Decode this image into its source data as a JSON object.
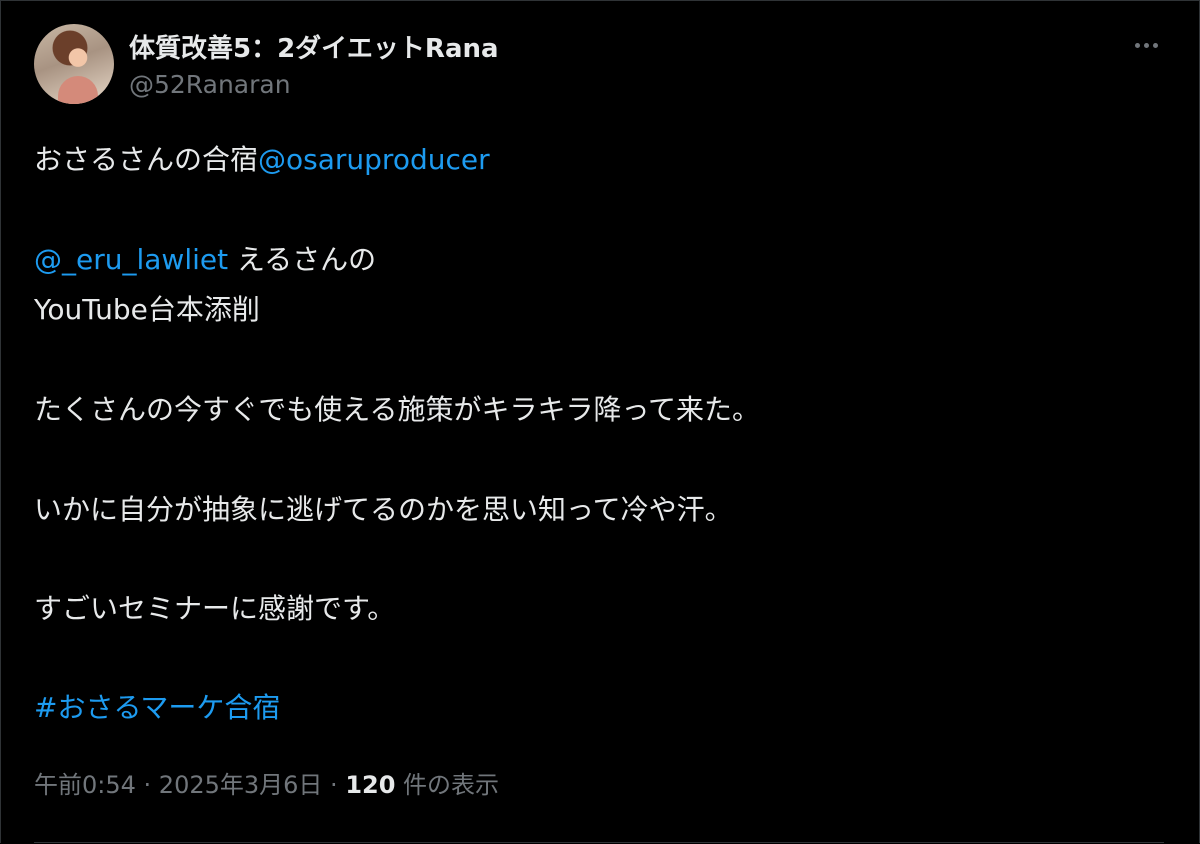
{
  "tweet": {
    "display_name": "体質改善5：2ダイエットRana",
    "handle": "@52Ranaran",
    "more_icon": "more-horizontal-icon",
    "lines": {
      "l1_text": "おさるさんの合宿",
      "l1_mention": "@osaruproducer",
      "l2_mention": "@_eru_lawliet",
      "l2_text": " えるさんの",
      "l3_text": "YouTube台本添削",
      "l4_text": "たくさんの今すぐでも使える施策がキラキラ降って来た。",
      "l5_text": "いかに自分が抽象に逃げてるのかを思い知って冷や汗。",
      "l6_text": "すごいセミナーに感謝です。",
      "l7_hashtag": "#おさるマーケ合宿"
    },
    "meta": {
      "time": "午前0:54",
      "separator1": " · ",
      "date": "2025年3月6日",
      "separator2": " · ",
      "views_count": "120",
      "views_label": " 件の表示"
    }
  },
  "colors": {
    "background": "#000000",
    "text": "#e7e9ea",
    "muted": "#71767b",
    "link": "#1d9bf0",
    "border": "#2f3336"
  }
}
